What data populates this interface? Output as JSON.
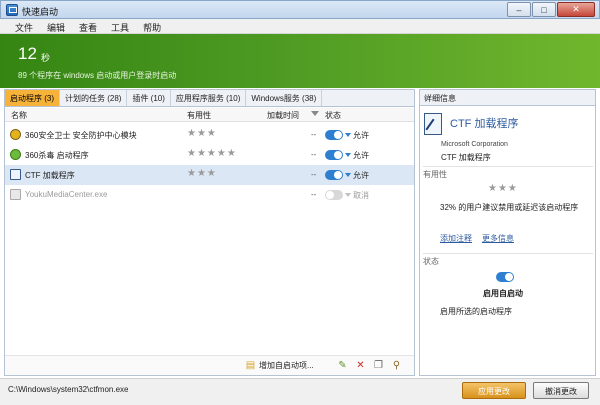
{
  "window": {
    "title": "快速启动"
  },
  "menu": [
    "文件",
    "编辑",
    "查看",
    "工具",
    "帮助"
  ],
  "banner": {
    "count": "12",
    "unit": "秒",
    "subtitle": "89 个程序在 windows 启动或用户登录时启动"
  },
  "tabs": [
    {
      "label": "启动程序 (3)",
      "active": true
    },
    {
      "label": "计划的任务 (28)"
    },
    {
      "label": "插件 (10)"
    },
    {
      "label": "应用程序服务 (10)"
    },
    {
      "label": "Windows服务 (38)"
    }
  ],
  "columns": {
    "name": "名称",
    "usefulness": "有用性",
    "delay": "加载时间",
    "status": "状态"
  },
  "rows": [
    {
      "name": "360安全卫士 安全防护中心模块",
      "stars": "★★★",
      "delay": "--",
      "status": "允许",
      "enabled": true
    },
    {
      "name": "360杀毒 启动程序",
      "stars": "★★★★★",
      "delay": "--",
      "status": "允许",
      "enabled": true
    },
    {
      "name": "CTF 加载程序",
      "stars": "★★★",
      "delay": "--",
      "status": "允许",
      "enabled": true,
      "selected": true
    },
    {
      "name": "YoukuMediaCenter.exe",
      "stars": "",
      "delay": "--",
      "status": "取消",
      "enabled": false
    }
  ],
  "toolbar": {
    "add_label": "增加自启动项..."
  },
  "details": {
    "header": "详细信息",
    "title": "CTF 加载程序",
    "company": "Microsoft Corporation",
    "product": "CTF 加载程序",
    "usefulness_label": "有用性",
    "stars": "★★★",
    "percent_text": "32% 的用户建议禁用或延迟该启动程序",
    "link_add_note": "添加注释",
    "link_more_info": "更多信息",
    "status_label": "状态",
    "state": "启用自启动",
    "description": "启用所选的启动程序"
  },
  "status_bar": {
    "path": "C:\\Windows\\system32\\ctfmon.exe",
    "apply": "应用更改",
    "cancel": "撤消更改"
  },
  "colors": {
    "banner_green": "#4d9a23",
    "active_tab": "#f7b23a",
    "toggle_on": "#2f7fd0",
    "link": "#2c5aa0"
  }
}
